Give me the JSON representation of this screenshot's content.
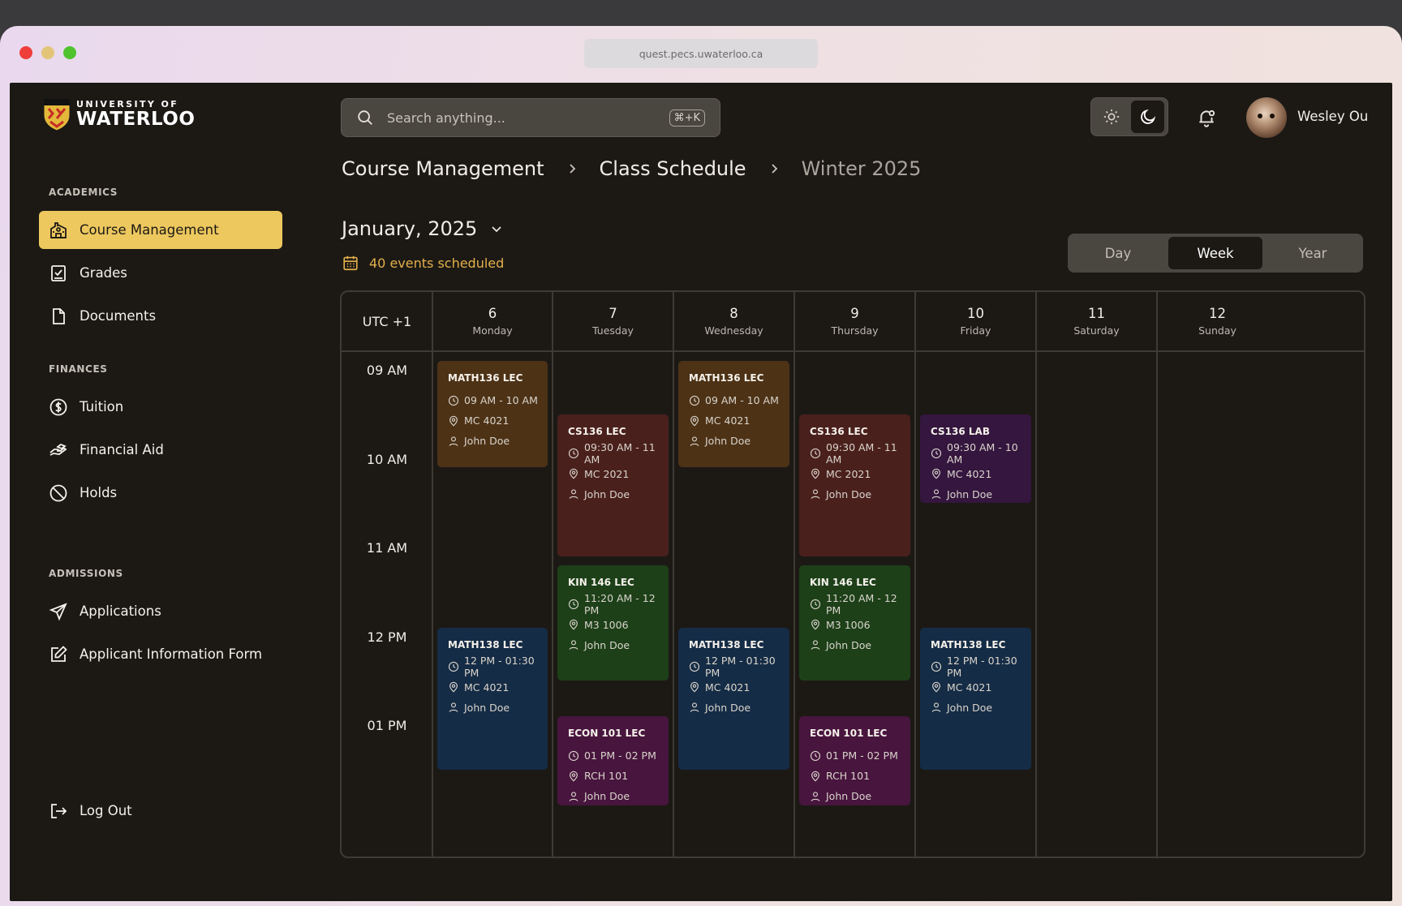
{
  "browser": {
    "url": "quest.pecs.uwaterloo.ca"
  },
  "logo": {
    "line1": "UNIVERSITY OF",
    "line2": "WATERLOO"
  },
  "sidebar": {
    "sections": [
      {
        "label": "ACADEMICS",
        "items": [
          {
            "label": "Course Management",
            "icon": "school-icon",
            "active": true
          },
          {
            "label": "Grades",
            "icon": "gradebook-icon"
          },
          {
            "label": "Documents",
            "icon": "document-icon"
          }
        ]
      },
      {
        "label": "FINANCES",
        "items": [
          {
            "label": "Tuition",
            "icon": "dollar-circle-icon"
          },
          {
            "label": "Financial Aid",
            "icon": "hand-money-icon"
          },
          {
            "label": "Holds",
            "icon": "prohibited-icon"
          }
        ]
      },
      {
        "label": "ADMISSIONS",
        "items": [
          {
            "label": "Applications",
            "icon": "send-icon"
          },
          {
            "label": "Applicant Information Form",
            "icon": "edit-form-icon"
          }
        ]
      }
    ],
    "logout": {
      "label": "Log Out",
      "icon": "logout-icon"
    }
  },
  "header": {
    "search_placeholder": "Search anything...",
    "search_shortcut": "⌘+K",
    "theme": "dark",
    "user_name": "Wesley Ou"
  },
  "breadcrumb": [
    "Course Management",
    "Class Schedule",
    "Winter 2025"
  ],
  "calendar": {
    "month_label": "January, 2025",
    "events_count_label": "40 events scheduled",
    "views": [
      "Day",
      "Week",
      "Year"
    ],
    "active_view": "Week",
    "timezone": "UTC +1",
    "days": [
      {
        "num": "6",
        "name": "Monday"
      },
      {
        "num": "7",
        "name": "Tuesday"
      },
      {
        "num": "8",
        "name": "Wednesday"
      },
      {
        "num": "9",
        "name": "Thursday"
      },
      {
        "num": "10",
        "name": "Friday"
      },
      {
        "num": "11",
        "name": "Saturday"
      },
      {
        "num": "12",
        "name": "Sunday"
      }
    ],
    "hours": [
      "09 AM",
      "10 AM",
      "11 AM",
      "12 PM",
      "01 PM"
    ],
    "colors": {
      "brown": "#4d3216",
      "red": "#4a201d",
      "purple": "#35163f",
      "green": "#1d4019",
      "blue": "#152c46",
      "magenta": "#48153e",
      "accent": "#edc85e",
      "events_text": "#e3b04b"
    },
    "events": [
      {
        "day": 0,
        "title": "MATH136 LEC",
        "time": "09 AM - 10 AM",
        "start": 9.0,
        "end": 10.2,
        "room": "MC 4021",
        "instructor": "John Doe",
        "color": "brown"
      },
      {
        "day": 2,
        "title": "MATH136 LEC",
        "time": "09 AM - 10 AM",
        "start": 9.0,
        "end": 10.2,
        "room": "MC 4021",
        "instructor": "John Doe",
        "color": "brown"
      },
      {
        "day": 1,
        "title": "CS136 LEC",
        "time": "09:30 AM - 11 AM",
        "start": 9.6,
        "end": 11.2,
        "room": "MC 2021",
        "instructor": "John Doe",
        "color": "red"
      },
      {
        "day": 3,
        "title": "CS136 LEC",
        "time": "09:30 AM - 11 AM",
        "start": 9.6,
        "end": 11.2,
        "room": "MC 2021",
        "instructor": "John Doe",
        "color": "red"
      },
      {
        "day": 4,
        "title": "CS136 LAB",
        "time": "09:30 AM - 10 AM",
        "start": 9.6,
        "end": 10.6,
        "room": "MC 4021",
        "instructor": "John Doe",
        "color": "purple"
      },
      {
        "day": 1,
        "title": "KIN 146 LEC",
        "time": "11:20 AM - 12 PM",
        "start": 11.3,
        "end": 12.6,
        "room": "M3 1006",
        "instructor": "John Doe",
        "color": "green"
      },
      {
        "day": 3,
        "title": "KIN 146 LEC",
        "time": "11:20 AM - 12 PM",
        "start": 11.3,
        "end": 12.6,
        "room": "M3 1006",
        "instructor": "John Doe",
        "color": "green"
      },
      {
        "day": 0,
        "title": "MATH138 LEC",
        "time": "12 PM - 01:30 PM",
        "start": 12.0,
        "end": 13.6,
        "room": "MC 4021",
        "instructor": "John Doe",
        "color": "blue"
      },
      {
        "day": 2,
        "title": "MATH138 LEC",
        "time": "12 PM - 01:30 PM",
        "start": 12.0,
        "end": 13.6,
        "room": "MC 4021",
        "instructor": "John Doe",
        "color": "blue"
      },
      {
        "day": 4,
        "title": "MATH138 LEC",
        "time": "12 PM - 01:30 PM",
        "start": 12.0,
        "end": 13.6,
        "room": "MC 4021",
        "instructor": "John Doe",
        "color": "blue"
      },
      {
        "day": 1,
        "title": "ECON 101 LEC",
        "time": "01 PM - 02 PM",
        "start": 13.0,
        "end": 14.0,
        "room": "RCH 101",
        "instructor": "John Doe",
        "color": "magenta"
      },
      {
        "day": 3,
        "title": "ECON 101 LEC",
        "time": "01 PM - 02 PM",
        "start": 13.0,
        "end": 14.0,
        "room": "RCH 101",
        "instructor": "John Doe",
        "color": "magenta"
      }
    ]
  }
}
